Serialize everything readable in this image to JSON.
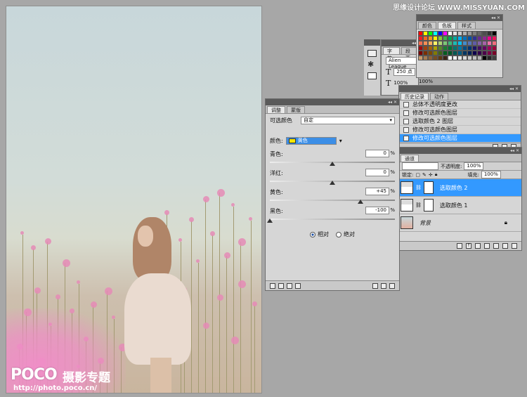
{
  "watermark": "思缘设计论坛 WWW.MISSYUAN.COM",
  "photo": {
    "logo": "POCO",
    "logo_cn": "摄影专题",
    "url": "http://photo.poco.cn/"
  },
  "swatches": {
    "tabs": [
      "颜色",
      "色板",
      "样式"
    ],
    "active_tab": 1,
    "colors": [
      "#ff0000",
      "#ffff00",
      "#00ff00",
      "#00ffff",
      "#0000ff",
      "#ff00ff",
      "#ffffff",
      "#e6e6e6",
      "#cccccc",
      "#b3b3b3",
      "#999999",
      "#808080",
      "#666666",
      "#4d4d4d",
      "#333333",
      "#000000",
      "#ed1c24",
      "#f26522",
      "#f7941d",
      "#fff200",
      "#8dc63f",
      "#39b54a",
      "#00a651",
      "#00a99d",
      "#00aeef",
      "#0072bc",
      "#0054a6",
      "#2e3192",
      "#662d91",
      "#92278f",
      "#ec008c",
      "#ed145b",
      "#f26c4f",
      "#f68e55",
      "#fbaf5c",
      "#fff467",
      "#acd372",
      "#7cc576",
      "#3bb878",
      "#1abbb4",
      "#00bff3",
      "#438ccb",
      "#5574b9",
      "#605ca8",
      "#855fa8",
      "#a763a8",
      "#f06ea9",
      "#f26d7d",
      "#9e0b0f",
      "#a0410d",
      "#a36209",
      "#aba000",
      "#598527",
      "#1a7b30",
      "#007236",
      "#00746b",
      "#0076a3",
      "#004b80",
      "#003471",
      "#1b1464",
      "#440e62",
      "#630460",
      "#9e005d",
      "#9e0039",
      "#790000",
      "#7b2e00",
      "#7d4900",
      "#827b00",
      "#406618",
      "#005e20",
      "#005826",
      "#005952",
      "#005b7f",
      "#003663",
      "#002157",
      "#0d004c",
      "#32004b",
      "#4b0049",
      "#7b0046",
      "#7a0026",
      "#c69c6e",
      "#a67c52",
      "#8c6239",
      "#754c24",
      "#603913",
      "#3c2415",
      "#ffffff",
      "#f2f2f2",
      "#e6e6e6",
      "#d9d9d9",
      "#cccccc",
      "#bfbfbf",
      "#b3b3b3",
      "#000000",
      "#262626",
      "#404040"
    ]
  },
  "character": {
    "tabs": [
      "字符",
      "段落"
    ],
    "font": "Alien League",
    "size": "250 点",
    "scale_v": "100%",
    "scale_h": "100%"
  },
  "history": {
    "tabs": [
      "历史记录",
      "动作"
    ],
    "items": [
      {
        "label": "总体不透明度更改",
        "selected": false
      },
      {
        "label": "修改可选颜色图层",
        "selected": false
      },
      {
        "label": "选取颜色 2 图层",
        "selected": false
      },
      {
        "label": "修改可选颜色图层",
        "selected": false
      },
      {
        "label": "修改可选颜色图层",
        "selected": true
      }
    ]
  },
  "adjustments": {
    "tabs": [
      "调整",
      "蒙版"
    ],
    "preset_label": "可选颜色",
    "preset_value": "自定",
    "color_label": "颜色:",
    "color_value": "黄色",
    "color_swatch": "#f5e600",
    "sliders": [
      {
        "label": "青色:",
        "value": "0",
        "unit": "%",
        "level": 0.5
      },
      {
        "label": "洋红:",
        "value": "0",
        "unit": "%",
        "level": 0.5
      },
      {
        "label": "黄色:",
        "value": "+45",
        "unit": "%",
        "level": 0.725
      },
      {
        "label": "黑色:",
        "value": "-100",
        "unit": "%",
        "level": 0.0
      }
    ],
    "mode_relative": "相对",
    "mode_absolute": "绝对",
    "mode_selected": "relative"
  },
  "layers": {
    "tabs": [
      "通道"
    ],
    "blend": "",
    "opacity_label": "不透明度:",
    "opacity": "100%",
    "lock_label": "锁定:",
    "fill_label": "填充:",
    "fill": "100%",
    "items": [
      {
        "label": "选取颜色 2",
        "selected": true
      },
      {
        "label": "选取颜色 1",
        "selected": false
      },
      {
        "label": "背景",
        "selected": false
      }
    ]
  }
}
